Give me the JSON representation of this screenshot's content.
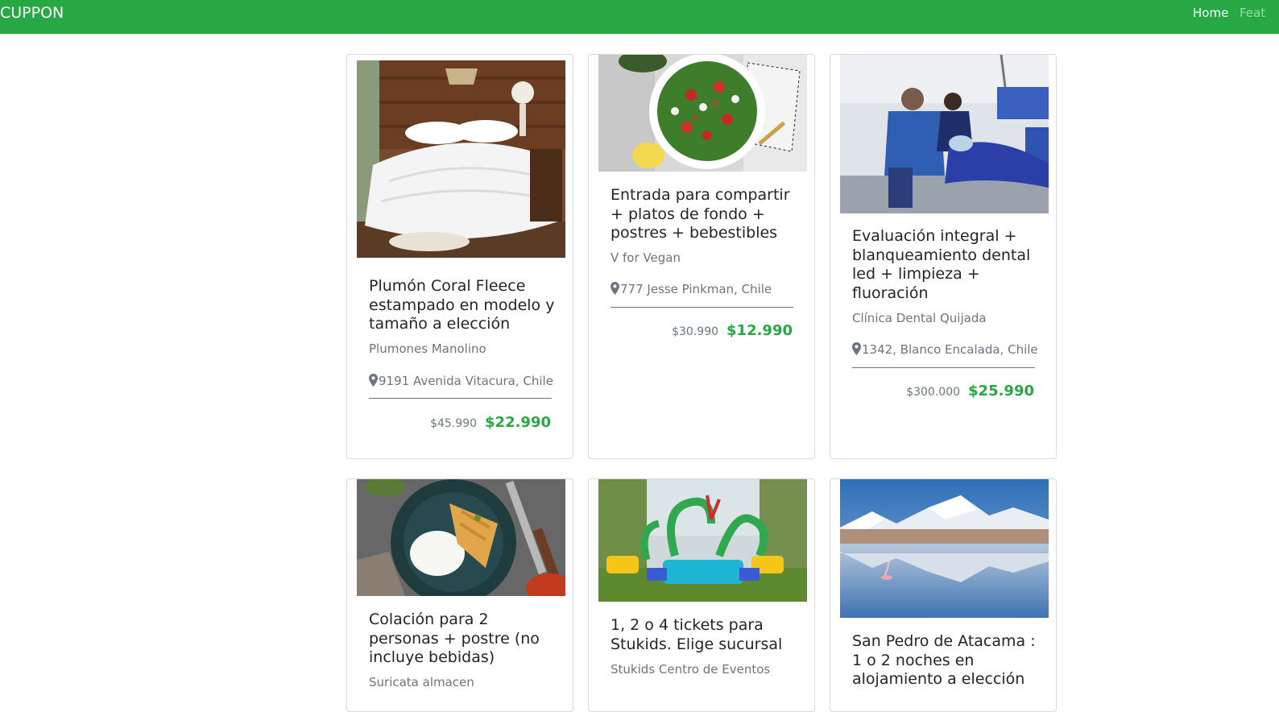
{
  "navbar": {
    "brand": "CUPPON",
    "links": [
      "Home",
      "Feat"
    ]
  },
  "colors": {
    "brand_green": "#28a745",
    "muted": "#6c757d",
    "title": "#212529"
  },
  "deals": [
    {
      "title": "Plumón Coral Fleece estampado en modelo y tamaño a elección",
      "merchant": "Plumones Manolino",
      "location": "9191 Avenida Vitacura, Chile",
      "old_price": "$45.990",
      "price": "$22.990",
      "image": "bed-with-white-comforter"
    },
    {
      "title": "Entrada para compartir + platos de fondo + postres + bebestibles",
      "merchant": "V for Vegan",
      "location": "777 Jesse Pinkman, Chile",
      "old_price": "$30.990",
      "price": "$12.990",
      "image": "salad-bowl"
    },
    {
      "title": "Evaluación integral + blanqueamiento dental led + limpieza + fluoración",
      "merchant": "Clínica Dental Quijada",
      "location": "1342, Blanco Encalada, Chile",
      "old_price": "$300.000",
      "price": "$25.990",
      "image": "dental-clinic"
    },
    {
      "title": "Colación para 2 personas + postre (no incluye bebidas)",
      "merchant": "Suricata almacen",
      "image": "chicken-rice-plate"
    },
    {
      "title": "1, 2 o 4 tickets para Stukids. Elige sucursal",
      "merchant": "Stukids Centro de Eventos",
      "image": "amusement-ride"
    },
    {
      "title": "San Pedro de Atacama : 1 o 2 noches en alojamiento a elección",
      "image": "atacama-lagoon-mountains"
    }
  ]
}
